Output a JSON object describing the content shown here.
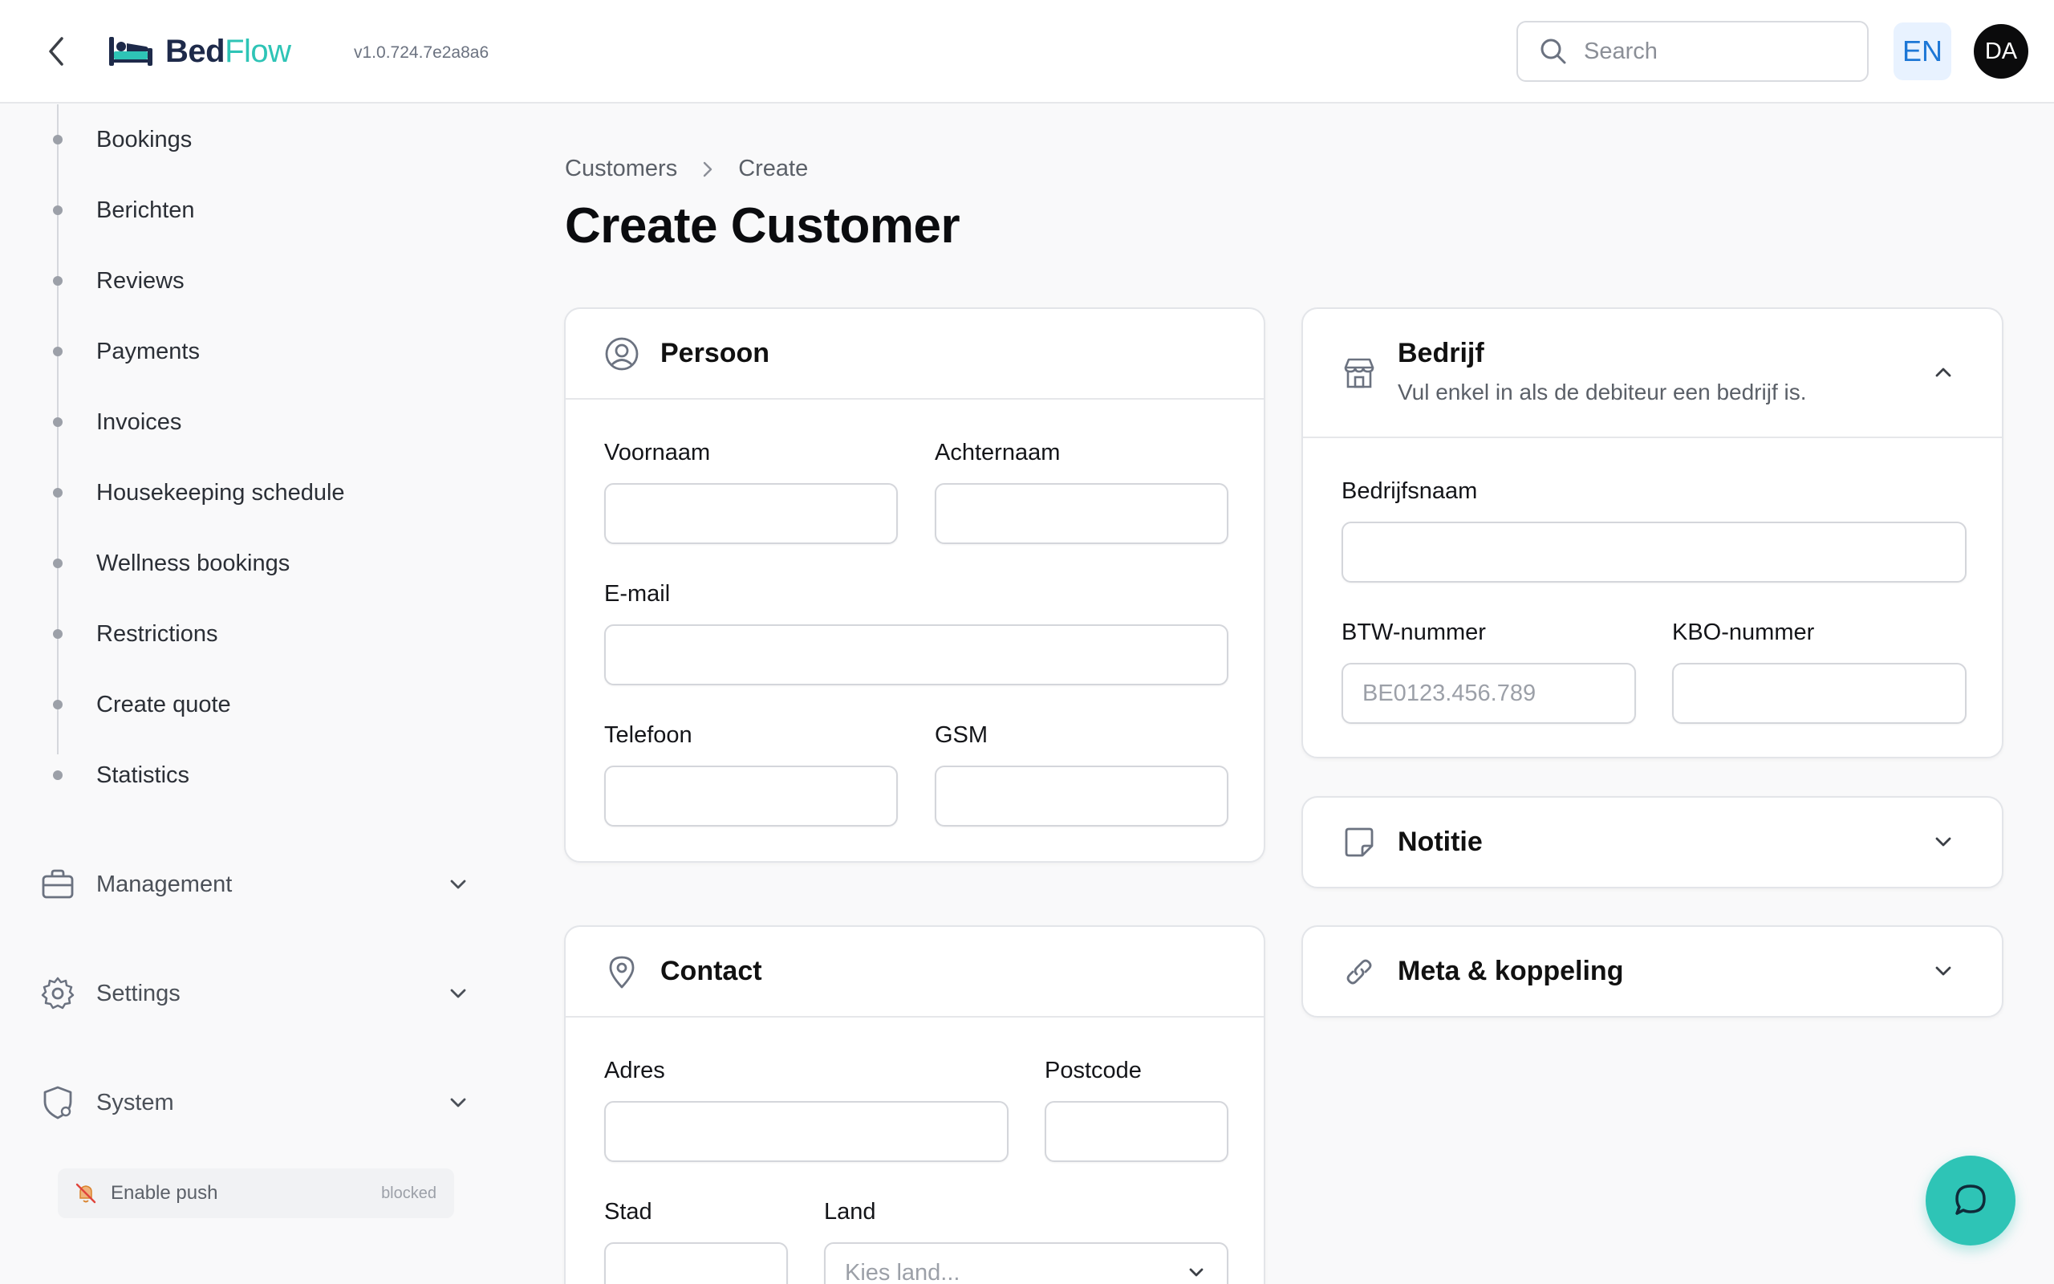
{
  "header": {
    "brand_part1": "Bed",
    "brand_part2": "Flow",
    "version": "v1.0.724.7e2a8a6",
    "search_placeholder": "Search",
    "language": "EN",
    "user_initials": "DA"
  },
  "sidebar": {
    "sub_items": [
      {
        "label": "Bookings"
      },
      {
        "label": "Berichten"
      },
      {
        "label": "Reviews"
      },
      {
        "label": "Payments"
      },
      {
        "label": "Invoices"
      },
      {
        "label": "Housekeeping schedule"
      },
      {
        "label": "Wellness bookings"
      },
      {
        "label": "Restrictions"
      },
      {
        "label": "Create quote"
      },
      {
        "label": "Statistics"
      }
    ],
    "groups": [
      {
        "label": "Management",
        "icon": "briefcase-icon"
      },
      {
        "label": "Settings",
        "icon": "gear-icon"
      },
      {
        "label": "System",
        "icon": "shield-gear-icon"
      }
    ],
    "push": {
      "label": "Enable push",
      "status": "blocked"
    }
  },
  "breadcrumb": {
    "parent": "Customers",
    "current": "Create"
  },
  "page_title": "Create Customer",
  "persoon": {
    "title": "Persoon",
    "voornaam_label": "Voornaam",
    "achternaam_label": "Achternaam",
    "email_label": "E-mail",
    "telefoon_label": "Telefoon",
    "gsm_label": "GSM"
  },
  "contact": {
    "title": "Contact",
    "adres_label": "Adres",
    "postcode_label": "Postcode",
    "stad_label": "Stad",
    "land_label": "Land",
    "land_placeholder": "Kies land..."
  },
  "bedrijf": {
    "title": "Bedrijf",
    "subtitle": "Vul enkel in als de debiteur een bedrijf is.",
    "bedrijfsnaam_label": "Bedrijfsnaam",
    "btw_label": "BTW-nummer",
    "btw_placeholder": "BE0123.456.789",
    "kbo_label": "KBO-nummer"
  },
  "notitie": {
    "title": "Notitie"
  },
  "meta": {
    "title": "Meta & koppeling"
  },
  "colors": {
    "accent": "#2ec4b6",
    "brand_dark": "#1e2a4a",
    "lang_bg": "#e8f2ff",
    "lang_text": "#1d77d6"
  }
}
